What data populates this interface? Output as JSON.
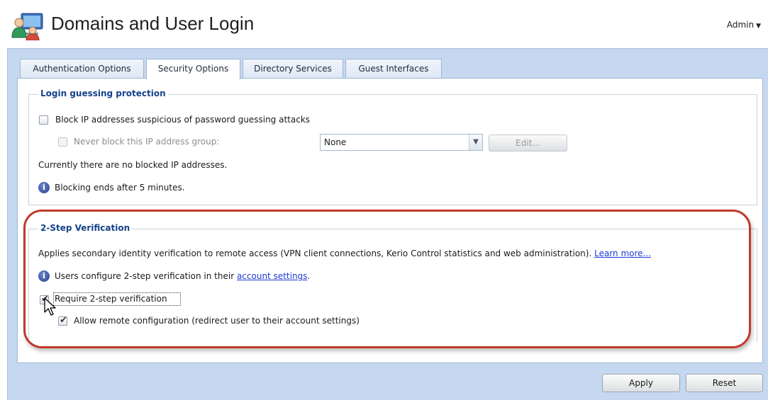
{
  "header": {
    "title": "Domains and User Login",
    "user_menu": "Admin"
  },
  "tabs": [
    {
      "label": "Authentication Options",
      "active": false
    },
    {
      "label": "Security Options",
      "active": true
    },
    {
      "label": "Directory Services",
      "active": false
    },
    {
      "label": "Guest Interfaces",
      "active": false
    }
  ],
  "login_guessing": {
    "legend": "Login guessing protection",
    "block_ip_label": "Block IP addresses suspicious of password guessing attacks",
    "block_ip_checked": false,
    "never_block_label": "Never block this IP address group:",
    "never_block_checked": false,
    "never_block_enabled": false,
    "ip_group_value": "None",
    "edit_button": "Edit...",
    "status_text": "Currently there are no blocked IP addresses.",
    "info_text": "Blocking ends after 5 minutes."
  },
  "two_step": {
    "legend": "2-Step Verification",
    "description": "Applies secondary identity verification to remote access (VPN client connections, Kerio Control statistics and web administration).",
    "learn_more": "Learn more...",
    "info_prefix": "Users configure 2-step verification in their",
    "info_link": "account settings",
    "info_suffix": ".",
    "require_label": "Require 2-step verification",
    "require_checked": true,
    "allow_remote_label": "Allow remote configuration (redirect user to their account settings)",
    "allow_remote_checked": true
  },
  "footer": {
    "apply_button": "Apply",
    "reset_button": "Reset"
  },
  "colors": {
    "workarea_bg": "#c5d8f0",
    "legend_text": "#15428b",
    "highlight": "#c03a2b",
    "link": "#1d3bd6"
  }
}
